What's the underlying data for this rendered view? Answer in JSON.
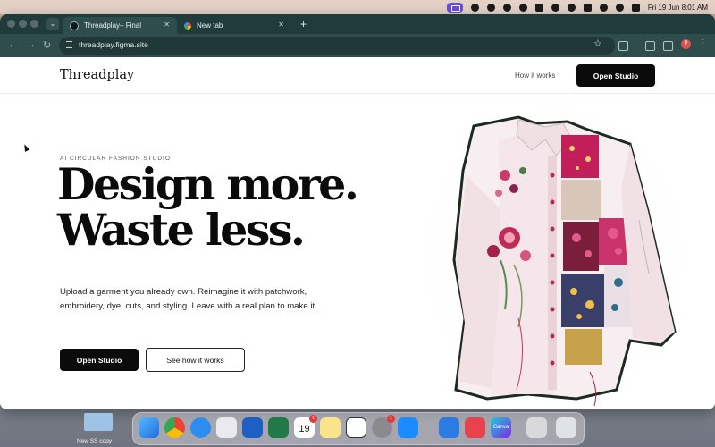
{
  "menubar": {
    "datetime": "Fri 19 Jun  8:01 AM"
  },
  "browser": {
    "tabs": [
      {
        "label": "Threadplay– Final",
        "active": true
      },
      {
        "label": "New tab",
        "active": false
      }
    ],
    "url": "threadplay.figma.site",
    "profile_initial": "P"
  },
  "site": {
    "logo": "Threadplay",
    "nav": {
      "how_it_works": "How it works",
      "open_studio": "Open Studio"
    },
    "hero": {
      "eyebrow": "AI CIRCULAR FASHION STUDIO",
      "headline_line1": "Design more.",
      "headline_line2": "Waste less.",
      "subtext": "Upload a garment you already own. Reimagine it with patchwork, embroidery, dye, cuts, and styling. Leave with a real plan to make it.",
      "primary_cta": "Open Studio",
      "secondary_cta": "See how it works"
    }
  },
  "desktop": {
    "file_label": "New SS copy"
  },
  "dock": {
    "calendar_day": "19",
    "calendar_badge": "1",
    "settings_badge": "1",
    "canva_label": "Canva"
  },
  "colors": {
    "browser_chrome": "#1f3b3a",
    "primary": "#0b0b0b",
    "accent": "#c8336b"
  }
}
